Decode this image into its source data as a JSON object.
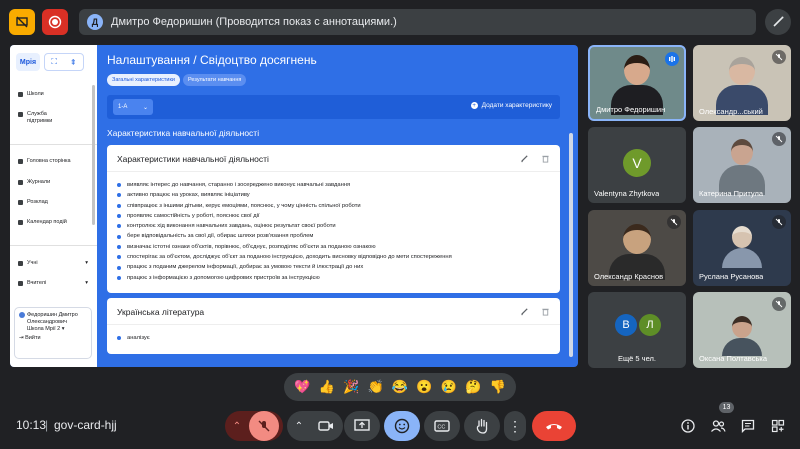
{
  "presenting_banner": {
    "avatar_letter": "Д",
    "text": "Дмитро Федоришин (Проводится показ с аннотациями.)"
  },
  "shared_app": {
    "sidebar": {
      "logo": "Мрія",
      "items": [
        {
          "label": "Школи",
          "icon": "school-icon"
        },
        {
          "label": "Служба підтримки",
          "icon": "headset-icon"
        },
        {
          "label": "Головна сторінка",
          "icon": "home-icon"
        },
        {
          "label": "Журнали",
          "icon": "journal-icon"
        },
        {
          "label": "Розклад",
          "icon": "schedule-icon"
        },
        {
          "label": "Календар подій",
          "icon": "calendar-icon"
        },
        {
          "label": "Учні",
          "icon": "students-icon"
        },
        {
          "label": "Вчителі",
          "icon": "teachers-icon"
        }
      ],
      "user": {
        "name": "Федоришин Дмитро Олександрович",
        "school": "Школа Мрії 2",
        "logout": "Вийти"
      }
    },
    "breadcrumb": {
      "section": "Налаштування",
      "separator": "/",
      "page": "Свідоцтво досягнень"
    },
    "tabs": [
      {
        "label": "Загальні характеристики",
        "active": true
      },
      {
        "label": "Результати навчання",
        "active": false
      }
    ],
    "class_select": "1-А",
    "add_button": "Додати характеристику",
    "section_title": "Характеристика навчальної діяльності",
    "cards": [
      {
        "title": "Характеристики навчальної діяльності",
        "items": [
          "виявляє інтерес до навчання, старанно і зосереджено виконує навчальні завдання",
          "активно працює на уроках, виявляє ініціативу",
          "співпрацює з іншими дітьми, керує емоціями, пояснює, у чому цінність спільної роботи",
          "проявляє самостійність у роботі, пояснює свої дії",
          "контролює хід виконання навчальних завдань, оцінює результат своєї роботи",
          "бере відповідальність за свої дії, обирає шляхи розв'язання проблем",
          "визначає істотні ознаки об'єктів, порівнює, об'єднує, розподіляє об'єкти за поданою ознакою",
          "спостерігає за об'єктом, досліджує об'єкт за поданою інструкцією, доходить висновку відповідно до мети спостереження",
          "працює з поданим джерелом інформації, добирає за умовою тексти й ілюстрації до них",
          "працює з інформацією з допомогою цифрових пристроїв за інструкцією"
        ]
      },
      {
        "title": "Українська література",
        "items": [
          "аналізує"
        ]
      }
    ]
  },
  "participants": [
    {
      "name": "Дмитро Федоришин",
      "state": "speaking"
    },
    {
      "name": "Олександр...ський",
      "state": "muted"
    },
    {
      "name": "Valentyna Zhytkova",
      "initial": "V",
      "avatar_color": "#6f9a2b",
      "state": "normal"
    },
    {
      "name": "Катерина Притула",
      "state": "muted"
    },
    {
      "name": "Олександр Краснов",
      "state": "muted"
    },
    {
      "name": "Руслана Русанова",
      "state": "muted"
    },
    {
      "name": "Ещё 5 чел.",
      "initials": [
        "В",
        "Л"
      ],
      "colors": [
        "#1565c0",
        "#5e8e27"
      ]
    },
    {
      "name": "Оксана Полтавська",
      "state": "muted"
    }
  ],
  "reactions": [
    "💖",
    "👍",
    "🎉",
    "👏",
    "😂",
    "😮",
    "😢",
    "🤔",
    "👎"
  ],
  "bottom_bar": {
    "time": "10:13",
    "divider": "|",
    "meeting_code": "gov-card-hjj",
    "people_count": "13"
  },
  "colors": {
    "app_blue": "#2f6fe6",
    "end_call_red": "#ea4335",
    "mic_off_red": "#f28b82",
    "active_blue": "#8ab4f8"
  }
}
